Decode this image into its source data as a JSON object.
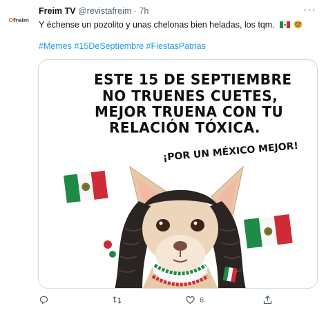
{
  "account": {
    "avatar_text": "freim",
    "display_name": "Freim TV",
    "handle": "@revistafreim",
    "separator": "·",
    "time": "7h"
  },
  "tweet": {
    "text": "Y échense un pozolito y unas chelonas bien heladas, los tqm.",
    "hashtags": [
      "#Memes",
      "#15DeSeptiembre",
      "#FiestasPatrias"
    ]
  },
  "meme": {
    "lines": [
      "ESTE 15 DE SEPTIEMBRE",
      "NO TRUENES  CUETES,",
      "MEJOR TRUENA CON TU",
      "RELACIÓN TÓXICA."
    ],
    "slogan": "¡POR UN MÉXICO MEJOR!"
  },
  "actions": {
    "reply_count": "",
    "retweet_count": "",
    "like_count": "6",
    "share_count": ""
  },
  "colors": {
    "link": "#1d9bf0",
    "secondary_text": "#536471",
    "border": "#cfd9de",
    "flag_green": "#1f8a46",
    "flag_red": "#ce2b37"
  },
  "icons": [
    "more-icon",
    "mexico-flag-emoji",
    "nerd-face-emoji",
    "reply-icon",
    "retweet-icon",
    "like-icon",
    "share-icon"
  ]
}
